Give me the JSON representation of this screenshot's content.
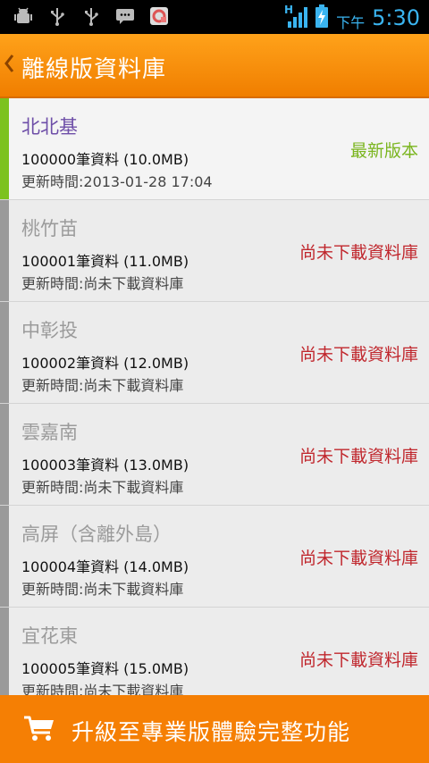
{
  "status_bar": {
    "icons": [
      "android-debug-icon",
      "usb-icon",
      "usb-icon",
      "message-icon",
      "app-notification-icon"
    ],
    "network_label": "H",
    "clock_ampm": "下午",
    "clock_time": "5:30"
  },
  "title_bar": {
    "back_icon": "chevron-left-icon",
    "title": "離線版資料庫"
  },
  "rows": [
    {
      "region": "北北基",
      "count": "100000筆資料 (10.0MB)",
      "time": "更新時間:2013-01-28 17:04",
      "status": "最新版本",
      "active": true
    },
    {
      "region": "桃竹苗",
      "count": "100001筆資料 (11.0MB)",
      "time": "更新時間:尚未下載資料庫",
      "status": "尚未下載資料庫",
      "active": false
    },
    {
      "region": "中彰投",
      "count": "100002筆資料 (12.0MB)",
      "time": "更新時間:尚未下載資料庫",
      "status": "尚未下載資料庫",
      "active": false
    },
    {
      "region": "雲嘉南",
      "count": "100003筆資料 (13.0MB)",
      "time": "更新時間:尚未下載資料庫",
      "status": "尚未下載資料庫",
      "active": false
    },
    {
      "region": "高屏（含離外島）",
      "count": "100004筆資料 (14.0MB)",
      "time": "更新時間:尚未下載資料庫",
      "status": "尚未下載資料庫",
      "active": false
    },
    {
      "region": "宜花東",
      "count": "100005筆資料 (15.0MB)",
      "time": "更新時間:尚未下載資料庫",
      "status": "尚未下載資料庫",
      "active": false
    }
  ],
  "bottom_bar": {
    "icon": "cart-icon",
    "label": "升級至專業版體驗完整功能"
  },
  "colors": {
    "accent_orange": "#f57f04",
    "active_green": "#7cc21e",
    "status_red": "#c0272d",
    "active_title_purple": "#6e4ea8"
  }
}
